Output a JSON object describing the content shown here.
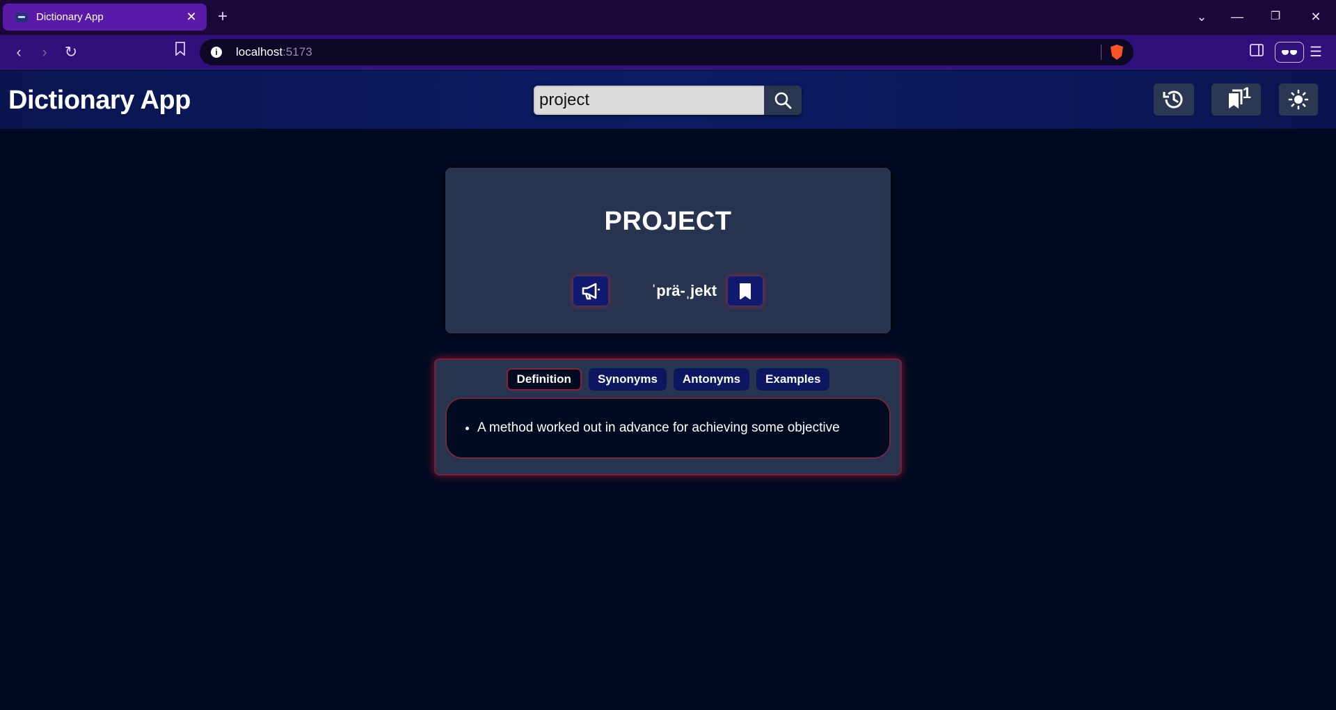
{
  "browser": {
    "tab_title": "Dictionary App",
    "url_host": "localhost",
    "url_port": ":5173"
  },
  "header": {
    "app_title": "Dictionary App",
    "search_value": "project",
    "bookmark_count": "1"
  },
  "word": {
    "title": "PROJECT",
    "phonetic": "ˈprä-ˌjekt"
  },
  "tabs": [
    {
      "label": "Definition",
      "active": true
    },
    {
      "label": "Synonyms",
      "active": false
    },
    {
      "label": "Antonyms",
      "active": false
    },
    {
      "label": "Examples",
      "active": false
    }
  ],
  "definitions": [
    "A method worked out in advance for achieving some objective"
  ],
  "colors": {
    "background": "#000a21",
    "header": "#0c1d66",
    "card": "#283350",
    "accent_glow": "#ff2846",
    "button": "#101a6e"
  }
}
